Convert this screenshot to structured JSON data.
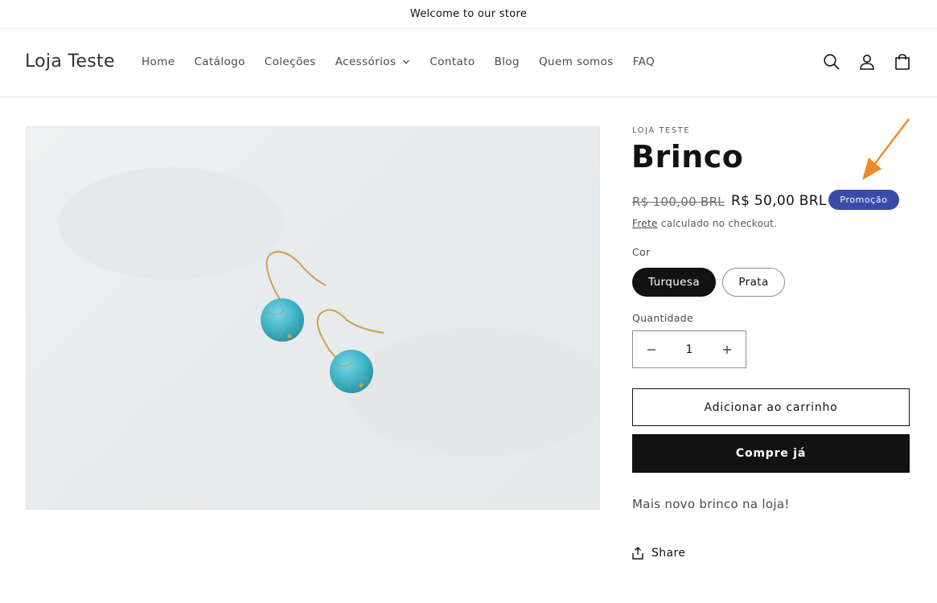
{
  "announcement": {
    "text": "Welcome to our store"
  },
  "header": {
    "logo": "Loja Teste",
    "nav": [
      {
        "label": "Home"
      },
      {
        "label": "Catálogo"
      },
      {
        "label": "Coleções"
      },
      {
        "label": "Acessórios",
        "has_dropdown": true
      },
      {
        "label": "Contato"
      },
      {
        "label": "Blog"
      },
      {
        "label": "Quem somos"
      },
      {
        "label": "FAQ"
      }
    ],
    "icons": [
      "search-icon",
      "account-icon",
      "cart-icon"
    ]
  },
  "product": {
    "vendor": "LOJA TESTE",
    "title": "Brinco",
    "price_regular": "R$ 100,00 BRL",
    "price_sale": "R$ 50,00 BRL",
    "badge": "Promoção",
    "shipping_link": "Frete",
    "shipping_text": "calculado no checkout.",
    "color_label": "Cor",
    "colors": [
      {
        "label": "Turquesa",
        "selected": true
      },
      {
        "label": "Prata",
        "selected": false
      }
    ],
    "quantity_label": "Quantidade",
    "quantity_value": "1",
    "add_to_cart": "Adicionar ao carrinho",
    "buy_now": "Compre já",
    "description": "Mais novo brinco na loja!",
    "share": "Share"
  },
  "colors": {
    "badge": "#3a4aa8",
    "primary_button": "#121212",
    "annotation_arrow": "#f08a24",
    "bead": "#3fb5c9"
  }
}
